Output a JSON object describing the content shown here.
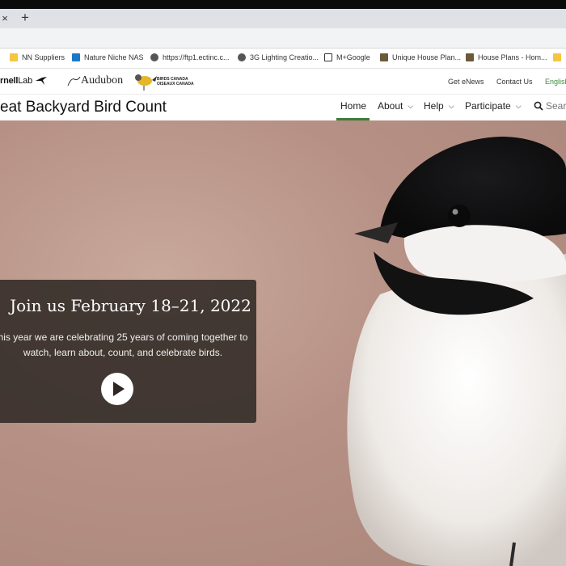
{
  "browser": {
    "tab_close": "×",
    "new_tab": "+",
    "bookmarks": [
      {
        "label": "NN Suppliers",
        "icon": "folder-icon"
      },
      {
        "label": "Nature Niche NAS",
        "icon": "nas-icon"
      },
      {
        "label": "https://ftp1.ectinc.c...",
        "icon": "globe-icon"
      },
      {
        "label": "3G Lighting Creatio...",
        "icon": "globe-icon"
      },
      {
        "label": "M+Google",
        "icon": "page-icon"
      },
      {
        "label": "Unique House Plan...",
        "icon": "image-icon"
      },
      {
        "label": "House Plans - Hom...",
        "icon": "image-icon"
      }
    ]
  },
  "site": {
    "logos": {
      "cornell_bold": "rnell",
      "cornell_light": "Lab",
      "audubon": "Audubon",
      "birds_canada_line1": "BIRDS CANADA",
      "birds_canada_line2": "OISEAUX CANADA"
    },
    "utility": {
      "enews": "Get eNews",
      "contact": "Contact Us",
      "language": "English"
    },
    "title": "eat Backyard Bird Count",
    "nav": {
      "home": "Home",
      "about": "About",
      "help": "Help",
      "participate": "Participate",
      "search": "Sear"
    }
  },
  "hero": {
    "heading": "Join us February 18–21, 2022",
    "body_line1": "his year we are celebrating 25 years of coming together to",
    "body_line2": "watch, learn about, count, and celebrate birds."
  },
  "colors": {
    "accent_green": "#3f7a3a",
    "english_link": "#3f8a3a",
    "card_bg": "#342c28"
  }
}
